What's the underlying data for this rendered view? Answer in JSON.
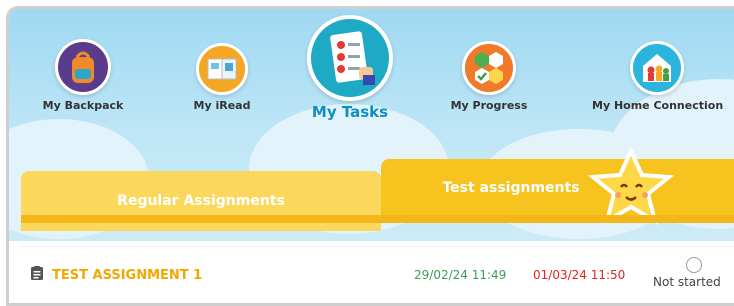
{
  "nav": {
    "items": [
      {
        "label": "My Backpack",
        "icon": "backpack-icon"
      },
      {
        "label": "My iRead",
        "icon": "book-icon"
      },
      {
        "label": "My Tasks",
        "icon": "clipboard-tasks-icon",
        "active": true
      },
      {
        "label": "My Progress",
        "icon": "progress-badges-icon"
      },
      {
        "label": "My Home Connection",
        "icon": "house-family-icon"
      }
    ]
  },
  "tabs": {
    "regular": "Regular Assignments",
    "test": "Test assignments",
    "active": "test"
  },
  "assignments": [
    {
      "title": "TEST ASSIGNMENT 1",
      "start": "29/02/24 11:49",
      "due": "01/03/24 11:50",
      "status": "Not started"
    }
  ],
  "colors": {
    "sky": "#9fd9f2",
    "tab_regular": "#fbd85c",
    "tab_test": "#f7c31f",
    "title": "#f1a800",
    "start_date": "#3a9d54",
    "due_date": "#e02424",
    "active_nav": "#0d8fc4"
  }
}
